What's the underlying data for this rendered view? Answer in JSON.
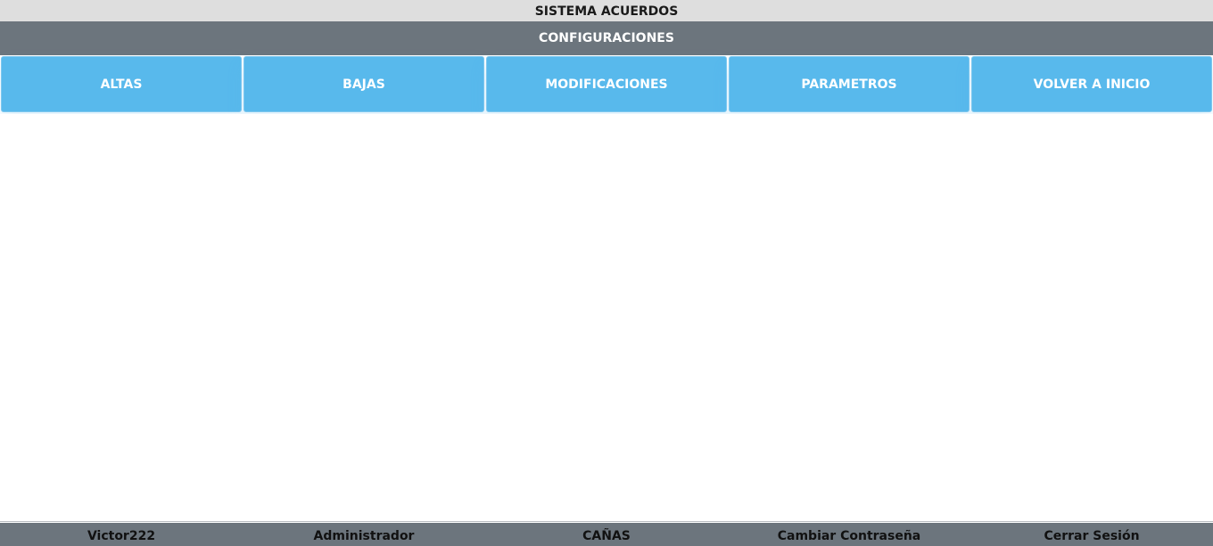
{
  "header": {
    "app_title": "SISTEMA ACUERDOS",
    "section_title": "CONFIGURACIONES"
  },
  "menu": {
    "items": [
      {
        "label": "ALTAS"
      },
      {
        "label": "BAJAS"
      },
      {
        "label": "MODIFICACIONES"
      },
      {
        "label": "PARAMETROS"
      },
      {
        "label": "VOLVER A INICIO"
      }
    ]
  },
  "footer": {
    "username": "Victor222",
    "role": "Administrador",
    "location": "CAÑAS",
    "change_password": "Cambiar Contraseña",
    "logout": "Cerrar Sesión"
  },
  "colors": {
    "top_bar": "#dedede",
    "section_bar": "#6c757d",
    "button": "#58b9ec",
    "footer": "#6c757d"
  }
}
